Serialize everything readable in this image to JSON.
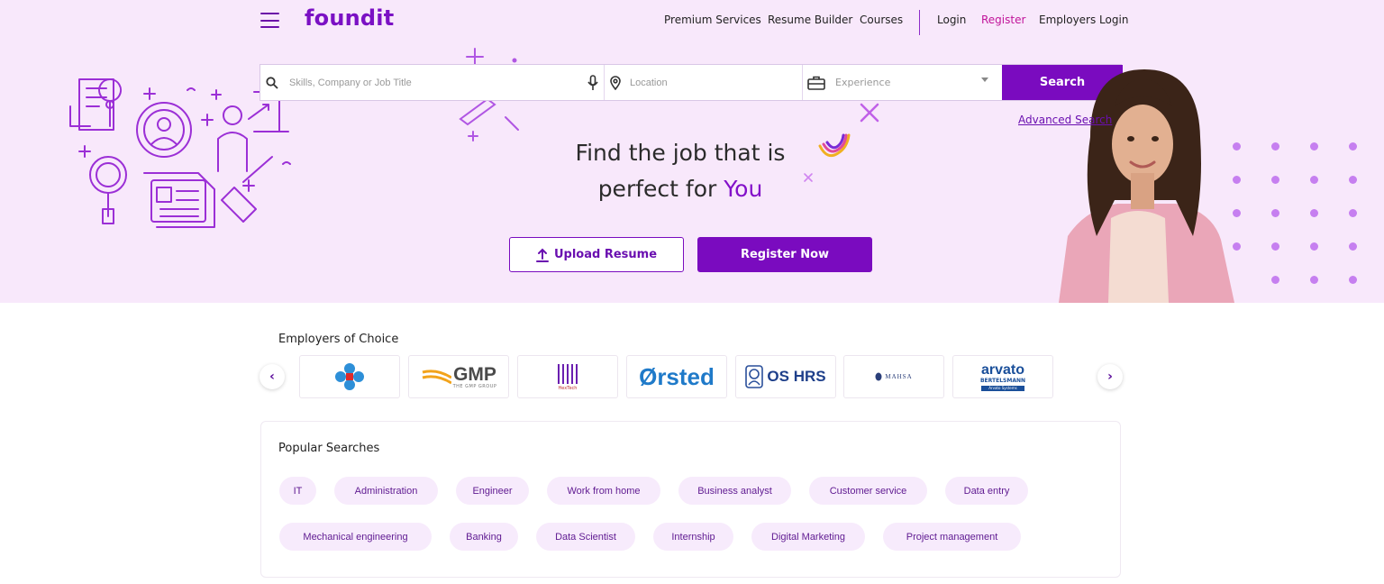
{
  "header": {
    "logo": "foundit",
    "nav": {
      "premium_services": "Premium Services",
      "resume_builder": "Resume Builder",
      "courses": "Courses",
      "login": "Login",
      "register": "Register",
      "employers_login": "Employers Login"
    }
  },
  "search": {
    "keyword_placeholder": "Skills, Company or Job Title",
    "location_placeholder": "Location",
    "experience_placeholder": "Experience",
    "search_label": "Search",
    "advanced_label": "Advanced Search"
  },
  "hero": {
    "headline_line1": "Find the job that is",
    "headline_line2_prefix": "perfect for ",
    "headline_highlight": "You",
    "upload_label": "Upload Resume",
    "register_label": "Register Now"
  },
  "employers": {
    "title": "Employers of Choice",
    "logos": {
      "gmp": "GMP",
      "gmp_sub": "THE GMP GROUP",
      "hektech": "HexTech",
      "orsted": "Ørsted",
      "oshrs": "OS HRS",
      "mahsa": "MAHSA",
      "arvato": "arvato",
      "arvato_sub": "BERTELSMANN",
      "arvato_tag": "Arvato Systems"
    }
  },
  "popular": {
    "title": "Popular Searches",
    "chips": [
      "IT",
      "Administration",
      "Engineer",
      "Work from home",
      "Business analyst",
      "Customer service",
      "Data entry",
      "Mechanical engineering",
      "Banking",
      "Data Scientist",
      "Internship",
      "Digital Marketing",
      "Project management"
    ]
  },
  "colors": {
    "brand": "#7a0bbf",
    "hero_bg": "#f8e8fb",
    "chip_bg": "#f7ebfc",
    "register_link": "#c1149a"
  }
}
